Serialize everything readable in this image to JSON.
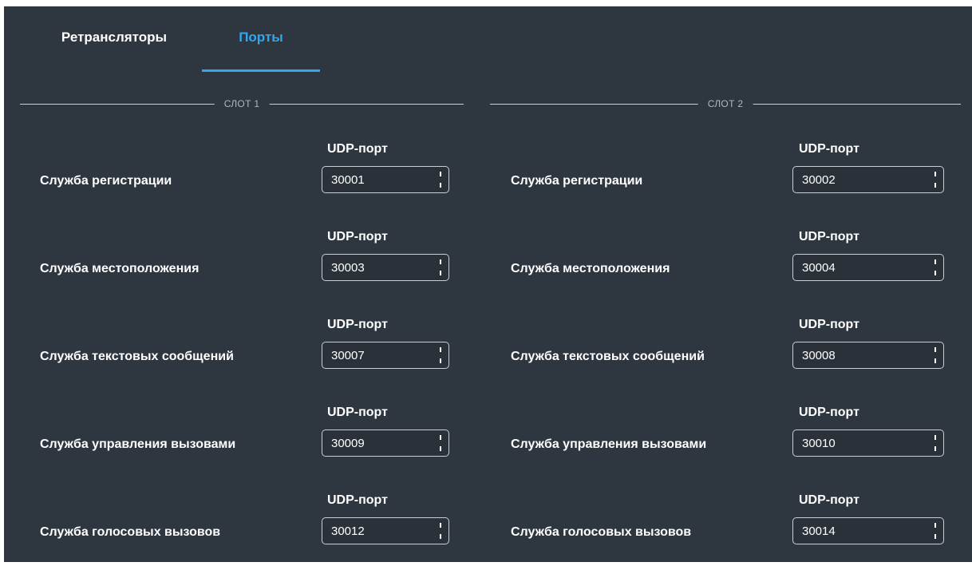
{
  "tabs": [
    {
      "label": "Ретрансляторы",
      "active": false
    },
    {
      "label": "Порты",
      "active": true
    }
  ],
  "colors": {
    "accent": "#2fa8f0",
    "panel": "#2e3640"
  },
  "slots": [
    {
      "title": "СЛОТ 1",
      "rows": [
        {
          "service": "Служба регистрации",
          "port_label": "UDP-порт",
          "port": "30001"
        },
        {
          "service": "Служба местоположения",
          "port_label": "UDP-порт",
          "port": "30003"
        },
        {
          "service": "Служба текстовых сообщений",
          "port_label": "UDP-порт",
          "port": "30007"
        },
        {
          "service": "Служба управления вызовами",
          "port_label": "UDP-порт",
          "port": "30009"
        },
        {
          "service": "Служба голосовых вызовов",
          "port_label": "UDP-порт",
          "port": "30012"
        }
      ]
    },
    {
      "title": "СЛОТ 2",
      "rows": [
        {
          "service": "Служба регистрации",
          "port_label": "UDP-порт",
          "port": "30002"
        },
        {
          "service": "Служба местоположения",
          "port_label": "UDP-порт",
          "port": "30004"
        },
        {
          "service": "Служба текстовых сообщений",
          "port_label": "UDP-порт",
          "port": "30008"
        },
        {
          "service": "Служба управления вызовами",
          "port_label": "UDP-порт",
          "port": "30010"
        },
        {
          "service": "Служба голосовых вызовов",
          "port_label": "UDP-порт",
          "port": "30014"
        }
      ]
    }
  ]
}
